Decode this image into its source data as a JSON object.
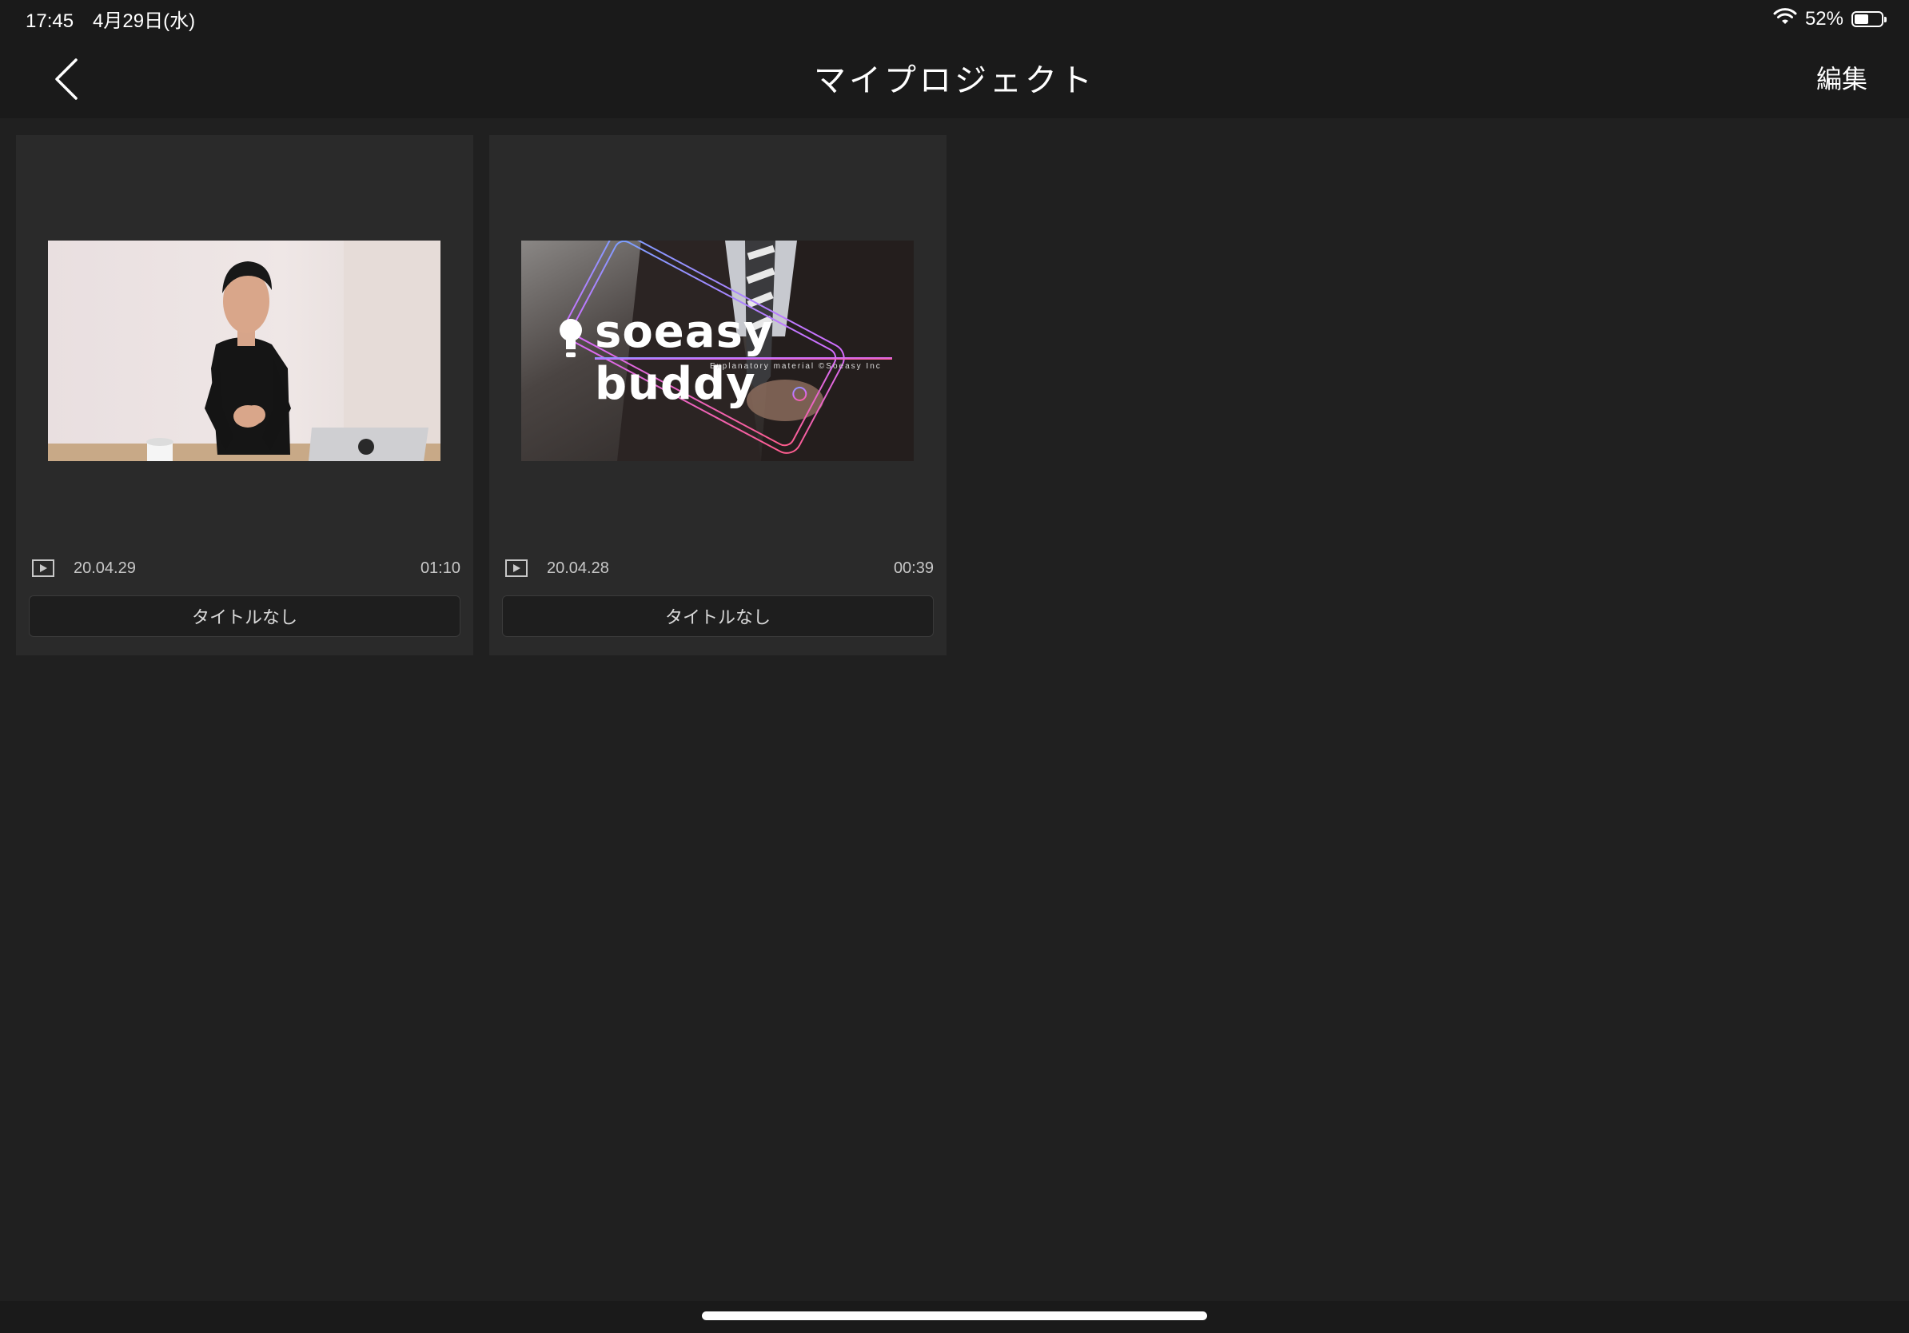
{
  "status_bar": {
    "time_date": "17:45　4月29日(水)",
    "battery_percent": "52%",
    "battery_level": 0.52,
    "icons": [
      "wifi-icon",
      "battery-icon"
    ]
  },
  "header": {
    "title": "マイプロジェクト",
    "edit_label": "編集",
    "back_icon": "chevron-left-icon"
  },
  "projects": [
    {
      "date": "20.04.29",
      "duration": "01:10",
      "title_label": "タイトルなし",
      "thumbnail": "photo of a man in a black polo sitting at a desk with a laptop"
    },
    {
      "date": "20.04.28",
      "duration": "00:39",
      "title_label": "タイトルなし",
      "thumbnail_brand": "soeasy buddy",
      "thumbnail_subtitle": "Explanatory material ©Soeasy Inc"
    }
  ],
  "colors": {
    "background": "#202020",
    "bar": "#1a1a1a",
    "card": "#2a2a2a",
    "text": "#ffffff"
  }
}
